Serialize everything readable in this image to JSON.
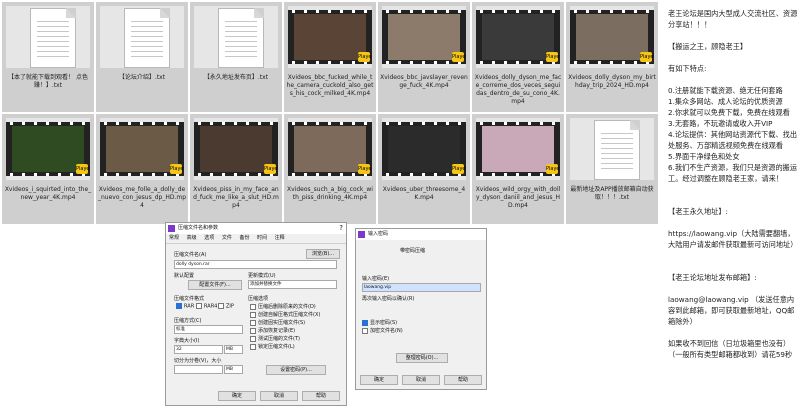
{
  "files": [
    {
      "name": "【本了就能下载到观看！ 点色赚！】.txt",
      "type": "doc"
    },
    {
      "name": "【论坛介绍】.txt",
      "type": "doc"
    },
    {
      "name": "【永久地址发布页】.txt",
      "type": "doc"
    },
    {
      "name": "Xvideos_bbc_fucked_while_the_camera_cuckold_also_gets_his_cock_milked_4K.mp4",
      "type": "video",
      "color": "#5a4436"
    },
    {
      "name": "Xvideos_bbc_javslayer_revenge_fuck_4K.mp4",
      "type": "video",
      "color": "#8c7a6b"
    },
    {
      "name": "Xvideos_dolly_dyson_me_face_correme_dos_veces_seguidas_dentro_de_su_cono_4K.mp4",
      "type": "video",
      "color": "#3a3a3a"
    },
    {
      "name": "Xvideos_dolly_dyson_my_birthday_trip_2024_HD.mp4",
      "type": "video",
      "color": "#7b6d60"
    },
    {
      "name": "Xvideos_i_squirted_into_the_new_year_4K.mp4",
      "type": "video",
      "color": "#2f4b22"
    },
    {
      "name": "Xvideos_me_folle_a_dolly_de_nuevo_con_jesus_dp_HD.mp4",
      "type": "video",
      "color": "#6a5a46"
    },
    {
      "name": "Xvideos_piss_in_my_face_and_fuck_me_like_a_slut_HD.mp4",
      "type": "video",
      "color": "#4a3a30"
    },
    {
      "name": "Xvideos_such_a_big_cock_with_piss_drinking_4K.mp4",
      "type": "video",
      "color": "#7d6a5a"
    },
    {
      "name": "Xvideos_uber_threesome_4K.mp4",
      "type": "video",
      "color": "#2b2b2b"
    },
    {
      "name": "Xvideos_wild_orgy_with_dolly_dyson_daniil_and_jesus_HD.mp4",
      "type": "video",
      "color": "#c9a8b8"
    },
    {
      "name": "最新地址及APP播放邮箱自动获取！！！.txt",
      "type": "doc"
    }
  ],
  "badge_text": "Player",
  "side_panel": {
    "lines": [
      "老王论坛是国内大型成人交流社区、资源分享站！！！",
      "",
      "【搬运之王，顾隐老王】",
      "",
      "有如下特点:",
      "",
      "0.注册就能下载资源、绝无任何套路",
      "1.集众多网站、成人论坛的优质资源",
      "2.你求就可以免费下载，免费在线观看",
      "3.无套路，不玩邀请或收入开VIP",
      "4.论坛提供：其他网站资源代下载、找出处服务、万部精选视频免费在线观看",
      "5.界面干净绿色和处女",
      "6.我们不生产资源，我们只是资源的搬运工。经过调整在顾隐老王家，请来！",
      "",
      "",
      "【老王永久地址】:",
      "",
      "https://laowang.vip（大陆需要翻墙，大陆用户请发邮件获取最新可访问地址）",
      "",
      "",
      "【老王论坛地址发布邮箱】:",
      "",
      "laowang@laowang.vip （发送任意内容到此邮箱，即可获取最新地址，QQ邮箱除外）",
      "",
      "如果收不到回信（日垃圾箱里也没有）",
      "（一般所有类型邮箱都收到）请花59秒"
    ]
  },
  "archive_dialog": {
    "title": "压缩文件名和参数",
    "close": "?",
    "tabs": [
      "常规",
      "高级",
      "选项",
      "文件",
      "备份",
      "时间",
      "注释"
    ],
    "archive_name_label": "压缩文件名(A)",
    "archive_name_value": "dolly dyson.rar",
    "browse_button": "浏览(B)...",
    "default_config_label": "默认配置",
    "config_button": "配置文件(F)...",
    "update_mode_label": "更新模式(U)",
    "update_mode_value": "添加并替换文件",
    "format_label": "压缩文件格式",
    "formats": [
      "RAR",
      "RAR4",
      "ZIP"
    ],
    "selected_format": "RAR",
    "method_label": "压缩方式(C)",
    "method_value": "标准",
    "dict_label": "字典大小(I)",
    "dict_value": "32",
    "dict_unit": "MB",
    "split_label": "切分为分卷(V)，大小",
    "split_unit": "MB",
    "options_label": "压缩选项",
    "options": [
      "压缩后删除原来的文件(D)",
      "创建自解压格式压缩文件(X)",
      "创建固实压缩文件(S)",
      "添加恢复记录(E)",
      "测试压缩的文件(T)",
      "锁定压缩文件(L)"
    ],
    "set_password_button": "设置密码(P)...",
    "ok": "确定",
    "cancel": "取消",
    "help": "帮助"
  },
  "password_dialog": {
    "title": "输入密码",
    "subtitle": "带密码压缩",
    "enter_label": "输入密码(E)",
    "password_value": "laowang.vip",
    "reenter_label": "再次输入密码以确认(R)",
    "show_password": "显示密码(S)",
    "encrypt_names": "加密文件名(N)",
    "manage_button": "整理密码(O)...",
    "ok": "确定",
    "cancel": "取消",
    "help": "帮助"
  }
}
